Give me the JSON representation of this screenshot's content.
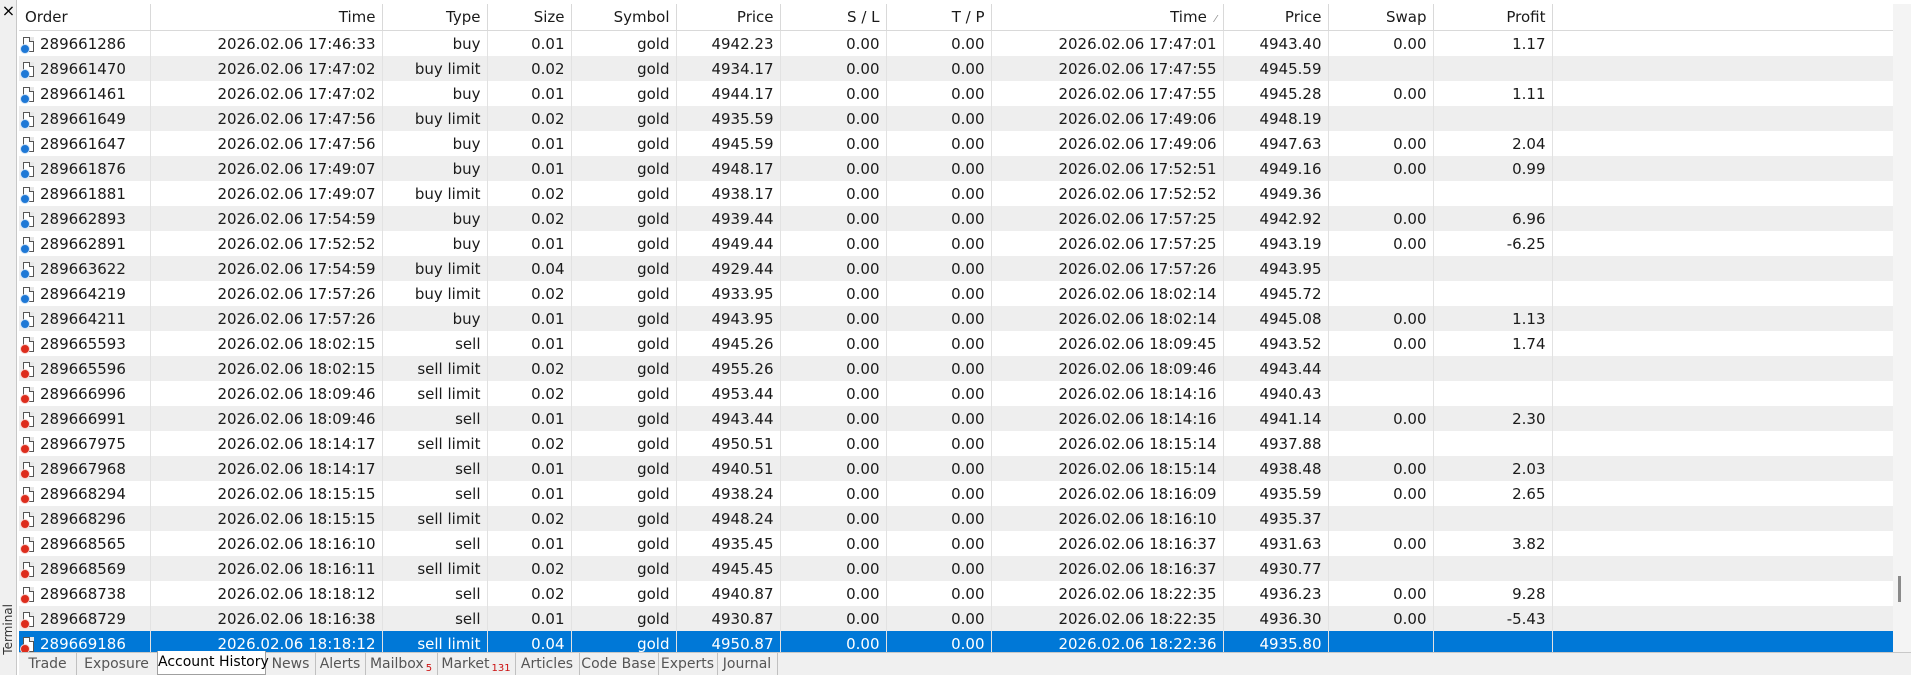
{
  "window": {
    "panel_label": "Terminal",
    "close_glyph": "×"
  },
  "columns": [
    "Order",
    "Time",
    "Type",
    "Size",
    "Symbol",
    "Price",
    "S / L",
    "T / P",
    "Time",
    "Price",
    "Swap",
    "Profit"
  ],
  "sort_indicator": "⁄",
  "rows": [
    {
      "order": "289661286",
      "time": "2026.02.06 17:46:33",
      "type": "buy",
      "size": "0.01",
      "symbol": "gold",
      "price": "4942.23",
      "sl": "0.00",
      "tp": "0.00",
      "close_time": "2026.02.06 17:47:01",
      "close_price": "4943.40",
      "swap": "0.00",
      "profit": "1.17",
      "side": "buy"
    },
    {
      "order": "289661470",
      "time": "2026.02.06 17:47:02",
      "type": "buy limit",
      "size": "0.02",
      "symbol": "gold",
      "price": "4934.17",
      "sl": "0.00",
      "tp": "0.00",
      "close_time": "2026.02.06 17:47:55",
      "close_price": "4945.59",
      "swap": "",
      "profit": "",
      "side": "buy"
    },
    {
      "order": "289661461",
      "time": "2026.02.06 17:47:02",
      "type": "buy",
      "size": "0.01",
      "symbol": "gold",
      "price": "4944.17",
      "sl": "0.00",
      "tp": "0.00",
      "close_time": "2026.02.06 17:47:55",
      "close_price": "4945.28",
      "swap": "0.00",
      "profit": "1.11",
      "side": "buy"
    },
    {
      "order": "289661649",
      "time": "2026.02.06 17:47:56",
      "type": "buy limit",
      "size": "0.02",
      "symbol": "gold",
      "price": "4935.59",
      "sl": "0.00",
      "tp": "0.00",
      "close_time": "2026.02.06 17:49:06",
      "close_price": "4948.19",
      "swap": "",
      "profit": "",
      "side": "buy"
    },
    {
      "order": "289661647",
      "time": "2026.02.06 17:47:56",
      "type": "buy",
      "size": "0.01",
      "symbol": "gold",
      "price": "4945.59",
      "sl": "0.00",
      "tp": "0.00",
      "close_time": "2026.02.06 17:49:06",
      "close_price": "4947.63",
      "swap": "0.00",
      "profit": "2.04",
      "side": "buy"
    },
    {
      "order": "289661876",
      "time": "2026.02.06 17:49:07",
      "type": "buy",
      "size": "0.01",
      "symbol": "gold",
      "price": "4948.17",
      "sl": "0.00",
      "tp": "0.00",
      "close_time": "2026.02.06 17:52:51",
      "close_price": "4949.16",
      "swap": "0.00",
      "profit": "0.99",
      "side": "buy"
    },
    {
      "order": "289661881",
      "time": "2026.02.06 17:49:07",
      "type": "buy limit",
      "size": "0.02",
      "symbol": "gold",
      "price": "4938.17",
      "sl": "0.00",
      "tp": "0.00",
      "close_time": "2026.02.06 17:52:52",
      "close_price": "4949.36",
      "swap": "",
      "profit": "",
      "side": "buy"
    },
    {
      "order": "289662893",
      "time": "2026.02.06 17:54:59",
      "type": "buy",
      "size": "0.02",
      "symbol": "gold",
      "price": "4939.44",
      "sl": "0.00",
      "tp": "0.00",
      "close_time": "2026.02.06 17:57:25",
      "close_price": "4942.92",
      "swap": "0.00",
      "profit": "6.96",
      "side": "buy"
    },
    {
      "order": "289662891",
      "time": "2026.02.06 17:52:52",
      "type": "buy",
      "size": "0.01",
      "symbol": "gold",
      "price": "4949.44",
      "sl": "0.00",
      "tp": "0.00",
      "close_time": "2026.02.06 17:57:25",
      "close_price": "4943.19",
      "swap": "0.00",
      "profit": "-6.25",
      "side": "buy"
    },
    {
      "order": "289663622",
      "time": "2026.02.06 17:54:59",
      "type": "buy limit",
      "size": "0.04",
      "symbol": "gold",
      "price": "4929.44",
      "sl": "0.00",
      "tp": "0.00",
      "close_time": "2026.02.06 17:57:26",
      "close_price": "4943.95",
      "swap": "",
      "profit": "",
      "side": "buy"
    },
    {
      "order": "289664219",
      "time": "2026.02.06 17:57:26",
      "type": "buy limit",
      "size": "0.02",
      "symbol": "gold",
      "price": "4933.95",
      "sl": "0.00",
      "tp": "0.00",
      "close_time": "2026.02.06 18:02:14",
      "close_price": "4945.72",
      "swap": "",
      "profit": "",
      "side": "buy"
    },
    {
      "order": "289664211",
      "time": "2026.02.06 17:57:26",
      "type": "buy",
      "size": "0.01",
      "symbol": "gold",
      "price": "4943.95",
      "sl": "0.00",
      "tp": "0.00",
      "close_time": "2026.02.06 18:02:14",
      "close_price": "4945.08",
      "swap": "0.00",
      "profit": "1.13",
      "side": "buy"
    },
    {
      "order": "289665593",
      "time": "2026.02.06 18:02:15",
      "type": "sell",
      "size": "0.01",
      "symbol": "gold",
      "price": "4945.26",
      "sl": "0.00",
      "tp": "0.00",
      "close_time": "2026.02.06 18:09:45",
      "close_price": "4943.52",
      "swap": "0.00",
      "profit": "1.74",
      "side": "sell"
    },
    {
      "order": "289665596",
      "time": "2026.02.06 18:02:15",
      "type": "sell limit",
      "size": "0.02",
      "symbol": "gold",
      "price": "4955.26",
      "sl": "0.00",
      "tp": "0.00",
      "close_time": "2026.02.06 18:09:46",
      "close_price": "4943.44",
      "swap": "",
      "profit": "",
      "side": "sell"
    },
    {
      "order": "289666996",
      "time": "2026.02.06 18:09:46",
      "type": "sell limit",
      "size": "0.02",
      "symbol": "gold",
      "price": "4953.44",
      "sl": "0.00",
      "tp": "0.00",
      "close_time": "2026.02.06 18:14:16",
      "close_price": "4940.43",
      "swap": "",
      "profit": "",
      "side": "sell"
    },
    {
      "order": "289666991",
      "time": "2026.02.06 18:09:46",
      "type": "sell",
      "size": "0.01",
      "symbol": "gold",
      "price": "4943.44",
      "sl": "0.00",
      "tp": "0.00",
      "close_time": "2026.02.06 18:14:16",
      "close_price": "4941.14",
      "swap": "0.00",
      "profit": "2.30",
      "side": "sell"
    },
    {
      "order": "289667975",
      "time": "2026.02.06 18:14:17",
      "type": "sell limit",
      "size": "0.02",
      "symbol": "gold",
      "price": "4950.51",
      "sl": "0.00",
      "tp": "0.00",
      "close_time": "2026.02.06 18:15:14",
      "close_price": "4937.88",
      "swap": "",
      "profit": "",
      "side": "sell"
    },
    {
      "order": "289667968",
      "time": "2026.02.06 18:14:17",
      "type": "sell",
      "size": "0.01",
      "symbol": "gold",
      "price": "4940.51",
      "sl": "0.00",
      "tp": "0.00",
      "close_time": "2026.02.06 18:15:14",
      "close_price": "4938.48",
      "swap": "0.00",
      "profit": "2.03",
      "side": "sell"
    },
    {
      "order": "289668294",
      "time": "2026.02.06 18:15:15",
      "type": "sell",
      "size": "0.01",
      "symbol": "gold",
      "price": "4938.24",
      "sl": "0.00",
      "tp": "0.00",
      "close_time": "2026.02.06 18:16:09",
      "close_price": "4935.59",
      "swap": "0.00",
      "profit": "2.65",
      "side": "sell"
    },
    {
      "order": "289668296",
      "time": "2026.02.06 18:15:15",
      "type": "sell limit",
      "size": "0.02",
      "symbol": "gold",
      "price": "4948.24",
      "sl": "0.00",
      "tp": "0.00",
      "close_time": "2026.02.06 18:16:10",
      "close_price": "4935.37",
      "swap": "",
      "profit": "",
      "side": "sell"
    },
    {
      "order": "289668565",
      "time": "2026.02.06 18:16:10",
      "type": "sell",
      "size": "0.01",
      "symbol": "gold",
      "price": "4935.45",
      "sl": "0.00",
      "tp": "0.00",
      "close_time": "2026.02.06 18:16:37",
      "close_price": "4931.63",
      "swap": "0.00",
      "profit": "3.82",
      "side": "sell"
    },
    {
      "order": "289668569",
      "time": "2026.02.06 18:16:11",
      "type": "sell limit",
      "size": "0.02",
      "symbol": "gold",
      "price": "4945.45",
      "sl": "0.00",
      "tp": "0.00",
      "close_time": "2026.02.06 18:16:37",
      "close_price": "4930.77",
      "swap": "",
      "profit": "",
      "side": "sell"
    },
    {
      "order": "289668738",
      "time": "2026.02.06 18:18:12",
      "type": "sell",
      "size": "0.02",
      "symbol": "gold",
      "price": "4940.87",
      "sl": "0.00",
      "tp": "0.00",
      "close_time": "2026.02.06 18:22:35",
      "close_price": "4936.23",
      "swap": "0.00",
      "profit": "9.28",
      "side": "sell"
    },
    {
      "order": "289668729",
      "time": "2026.02.06 18:16:38",
      "type": "sell",
      "size": "0.01",
      "symbol": "gold",
      "price": "4930.87",
      "sl": "0.00",
      "tp": "0.00",
      "close_time": "2026.02.06 18:22:35",
      "close_price": "4936.30",
      "swap": "0.00",
      "profit": "-5.43",
      "side": "sell"
    },
    {
      "order": "289669186",
      "time": "2026.02.06 18:18:12",
      "type": "sell limit",
      "size": "0.04",
      "symbol": "gold",
      "price": "4950.87",
      "sl": "0.00",
      "tp": "0.00",
      "close_time": "2026.02.06 18:22:36",
      "close_price": "4935.80",
      "swap": "",
      "profit": "",
      "side": "sell",
      "selected": true
    }
  ],
  "tabs": [
    {
      "label": "Trade"
    },
    {
      "label": "Exposure"
    },
    {
      "label": "Account History",
      "active": true
    },
    {
      "label": "News"
    },
    {
      "label": "Alerts"
    },
    {
      "label": "Mailbox",
      "badge": "5"
    },
    {
      "label": "Market",
      "badge": "131"
    },
    {
      "label": "Articles"
    },
    {
      "label": "Code Base"
    },
    {
      "label": "Experts"
    },
    {
      "label": "Journal"
    }
  ],
  "colors": {
    "buy_dot": "#1e78d6",
    "sell_dot": "#dd2c1c",
    "selection": "#0078d7",
    "badge": "#cc1111"
  }
}
